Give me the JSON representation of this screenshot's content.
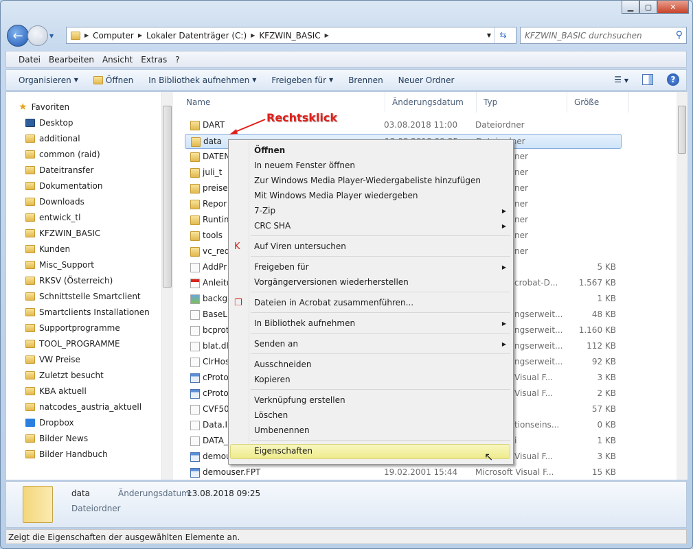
{
  "window": {
    "buttons": [
      "minimize",
      "maximize",
      "close"
    ]
  },
  "address": {
    "crumbs": [
      "Computer",
      "Lokaler Datenträger (C:)",
      "KFZWIN_BASIC"
    ],
    "search_placeholder": "KFZWIN_BASIC durchsuchen"
  },
  "menubar": [
    "Datei",
    "Bearbeiten",
    "Ansicht",
    "Extras",
    "?"
  ],
  "toolbar": {
    "organize": "Organisieren",
    "open": "Öffnen",
    "library": "In Bibliothek aufnehmen",
    "share": "Freigeben für",
    "burn": "Brennen",
    "new_folder": "Neuer Ordner"
  },
  "sidebar": {
    "favorites": "Favoriten",
    "items": [
      "Desktop",
      "additional",
      "common (raid)",
      "Dateitransfer",
      "Dokumentation",
      "Downloads",
      "entwick_tl",
      "KFZWIN_BASIC",
      "Kunden",
      "Misc_Support",
      "RKSV (Österreich)",
      "Schnittstelle Smartclient",
      "Smartclients Installationen",
      "Supportprogramme",
      "TOOL_PROGRAMME",
      "VW Preise",
      "Zuletzt besucht",
      "KBA aktuell",
      "natcodes_austria_aktuell",
      "Dropbox",
      "Bilder News",
      "Bilder Handbuch"
    ]
  },
  "columns": {
    "name": "Name",
    "date": "Änderungsdatum",
    "type": "Typ",
    "size": "Größe"
  },
  "files": [
    {
      "name": "DART",
      "date": "03.08.2018 11:00",
      "type": "Dateiordner",
      "size": "",
      "icon": "folder"
    },
    {
      "name": "data",
      "date": "13.08.2018 09:25",
      "type": "Dateiordner",
      "size": "",
      "icon": "folder",
      "selected": true
    },
    {
      "name": "DATEN",
      "date": "",
      "type": "ner",
      "size": "",
      "icon": "folder",
      "frag": true
    },
    {
      "name": "juli_t",
      "date": "",
      "type": "ner",
      "size": "",
      "icon": "folder",
      "frag": true
    },
    {
      "name": "preise",
      "date": "",
      "type": "ner",
      "size": "",
      "icon": "folder",
      "frag": true
    },
    {
      "name": "Repor",
      "date": "",
      "type": "ner",
      "size": "",
      "icon": "folder",
      "frag": true
    },
    {
      "name": "Runtim",
      "date": "",
      "type": "ner",
      "size": "",
      "icon": "folder",
      "frag": true
    },
    {
      "name": "tools",
      "date": "",
      "type": "ner",
      "size": "",
      "icon": "folder",
      "frag": true
    },
    {
      "name": "vc_red",
      "date": "",
      "type": "ner",
      "size": "",
      "icon": "folder",
      "frag": true
    },
    {
      "name": "AddPr",
      "date": "",
      "type": "",
      "size": "5 KB",
      "icon": "file"
    },
    {
      "name": "Anleitu",
      "date": "",
      "type": "crobat-D...",
      "size": "1.567 KB",
      "icon": "pdf",
      "frag": true
    },
    {
      "name": "backg",
      "date": "",
      "type": "",
      "size": "1 KB",
      "icon": "image"
    },
    {
      "name": "BaseLi",
      "date": "",
      "type": "ngserweit...",
      "size": "48 KB",
      "icon": "dll",
      "frag": true
    },
    {
      "name": "bcprot",
      "date": "",
      "type": "ngserweit...",
      "size": "1.160 KB",
      "icon": "dll",
      "frag": true
    },
    {
      "name": "blat.dl",
      "date": "",
      "type": "ngserweit...",
      "size": "112 KB",
      "icon": "dll",
      "frag": true
    },
    {
      "name": "ClrHos",
      "date": "",
      "type": "ngserweit...",
      "size": "92 KB",
      "icon": "dll",
      "frag": true
    },
    {
      "name": "cProto",
      "date": "",
      "type": "Visual F...",
      "size": "3 KB",
      "icon": "table",
      "frag": true
    },
    {
      "name": "cProto",
      "date": "",
      "type": "Visual F...",
      "size": "2 KB",
      "icon": "table",
      "frag": true
    },
    {
      "name": "CVF50",
      "date": "",
      "type": "",
      "size": "57 KB",
      "icon": "file"
    },
    {
      "name": "Data.I",
      "date": "",
      "type": "tionseins...",
      "size": "0 KB",
      "icon": "ini",
      "frag": true
    },
    {
      "name": "DATA_",
      "date": "",
      "type": "i",
      "size": "1 KB",
      "icon": "file",
      "frag": true
    },
    {
      "name": "demou",
      "date": "",
      "type": "Visual F...",
      "size": "3 KB",
      "icon": "table",
      "frag": true
    },
    {
      "name": "demouser.FPT",
      "date": "19.02.2001 15:44",
      "type": "Microsoft Visual F...",
      "size": "15 KB",
      "icon": "table"
    }
  ],
  "annotation": "Rechtsklick",
  "context_menu": [
    {
      "label": "Öffnen",
      "bold": true
    },
    {
      "label": "In neuem Fenster öffnen"
    },
    {
      "label": "Zur Windows Media Player-Wiedergabeliste hinzufügen"
    },
    {
      "label": "Mit Windows Media Player wiedergeben"
    },
    {
      "label": "7-Zip",
      "submenu": true
    },
    {
      "label": "CRC SHA",
      "submenu": true
    },
    {
      "sep": true
    },
    {
      "label": "Auf Viren untersuchen",
      "icon": "kaspersky"
    },
    {
      "sep": true
    },
    {
      "label": "Freigeben für",
      "submenu": true
    },
    {
      "label": "Vorgängerversionen wiederherstellen"
    },
    {
      "sep": true
    },
    {
      "label": "Dateien in Acrobat zusammenführen...",
      "icon": "acrobat"
    },
    {
      "sep": true
    },
    {
      "label": "In Bibliothek aufnehmen",
      "submenu": true
    },
    {
      "sep": true
    },
    {
      "label": "Senden an",
      "submenu": true
    },
    {
      "sep": true
    },
    {
      "label": "Ausschneiden"
    },
    {
      "label": "Kopieren"
    },
    {
      "sep": true
    },
    {
      "label": "Verknüpfung erstellen"
    },
    {
      "label": "Löschen"
    },
    {
      "label": "Umbenennen"
    },
    {
      "sep": true
    },
    {
      "label": "Eigenschaften",
      "highlighted": true
    }
  ],
  "details": {
    "name": "data",
    "date_label": "Änderungsdatum:",
    "date": "13.08.2018 09:25",
    "type": "Dateiordner"
  },
  "status": "Zeigt die Eigenschaften der ausgewählten Elemente an.",
  "colors": {
    "selection": "#cfe4fa",
    "highlight": "#eeeb8c",
    "annotation": "#e0201a"
  }
}
